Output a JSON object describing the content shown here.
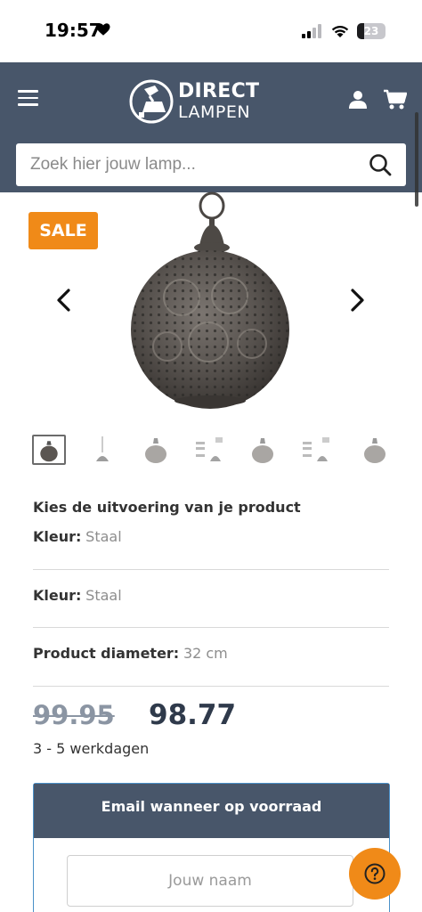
{
  "status_bar": {
    "time": "19:57",
    "battery": "23",
    "icons": [
      "heart-icon",
      "signal-icon",
      "wifi-icon",
      "battery-icon"
    ]
  },
  "header": {
    "logo_line1": "DIRECT",
    "logo_line2": "LAMPEN",
    "icons": [
      "menu-icon",
      "account-icon",
      "cart-icon"
    ],
    "background": "#48566a"
  },
  "search": {
    "placeholder": "Zoek hier jouw lamp...",
    "value": ""
  },
  "product": {
    "badge": "SALE",
    "badge_color": "#f08a18",
    "thumbnail_count": 7,
    "choose_title": "Kies de uitvoering van je product",
    "options": [
      {
        "label": "Kleur:",
        "value": "Staal"
      },
      {
        "label": "Kleur:",
        "value": "Staal"
      },
      {
        "label": "Product diameter:",
        "value": "32 cm"
      }
    ],
    "old_price": "99.95",
    "new_price": "98.77",
    "delivery": "3 - 5 werkdagen"
  },
  "stock_alert": {
    "title": "Email wanneer op voorraad",
    "name_placeholder": "Jouw naam"
  },
  "help": {
    "icon": "question-icon",
    "color": "#f08a18"
  }
}
